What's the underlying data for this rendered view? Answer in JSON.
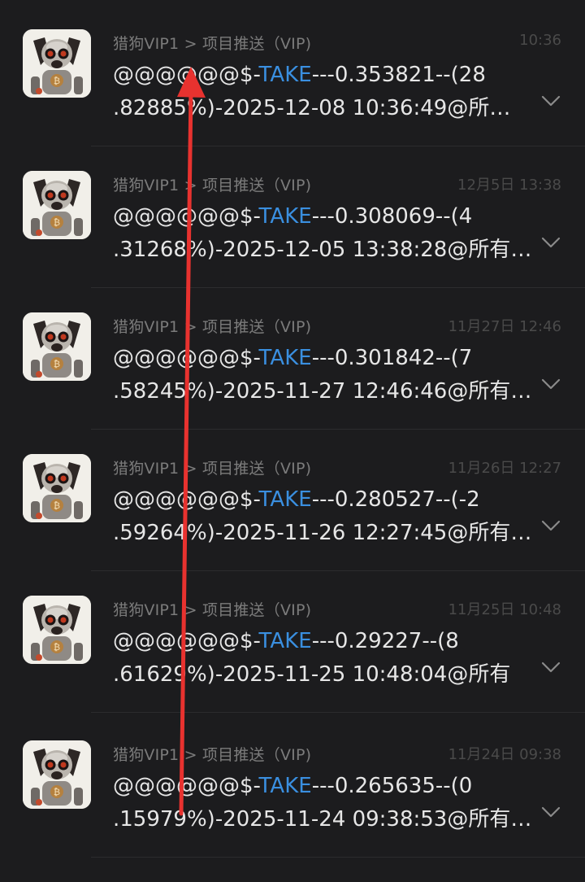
{
  "messages": [
    {
      "sender": "猎狗VIP1 > 项目推送（VIP)",
      "time": "10:36",
      "line1_prefix": "@@@@@@$-",
      "keyword": "TAKE",
      "line1_suffix": "---0.353821--(28",
      "line2": ".82885%)-2025-12-08 10:36:49@所…"
    },
    {
      "sender": "猎狗VIP1 > 项目推送（VIP)",
      "time": "12月5日 13:38",
      "line1_prefix": "@@@@@@$-",
      "keyword": "TAKE",
      "line1_suffix": "---0.308069--(4",
      "line2": ".31268%)-2025-12-05 13:38:28@所有…"
    },
    {
      "sender": "猎狗VIP1 > 项目推送（VIP)",
      "time": "11月27日 12:46",
      "line1_prefix": "@@@@@@$-",
      "keyword": "TAKE",
      "line1_suffix": "---0.301842--(7",
      "line2": ".58245%)-2025-11-27 12:46:46@所有…"
    },
    {
      "sender": "猎狗VIP1 > 项目推送（VIP)",
      "time": "11月26日 12:27",
      "line1_prefix": "@@@@@@$-",
      "keyword": "TAKE",
      "line1_suffix": "---0.280527--(-2",
      "line2": ".59264%)-2025-11-26 12:27:45@所有…"
    },
    {
      "sender": "猎狗VIP1 > 项目推送（VIP)",
      "time": "11月25日 10:48",
      "line1_prefix": "@@@@@@$-",
      "keyword": "TAKE",
      "line1_suffix": "---0.29227--(8",
      "line2": ".61629%)-2025-11-25 10:48:04@所有"
    },
    {
      "sender": "猎狗VIP1 > 项目推送（VIP)",
      "time": "11月24日 09:38",
      "line1_prefix": "@@@@@@$-",
      "keyword": "TAKE",
      "line1_suffix": "---0.265635--(0",
      "line2": ".15979%)-2025-11-24 09:38:53@所有…"
    }
  ],
  "colors": {
    "background": "#1c1c1e",
    "keyword": "#3a8fe0",
    "annotation_arrow": "#e8322f"
  },
  "icons": {
    "avatar": "robot-dog-avatar-icon",
    "expand": "chevron-down-icon"
  }
}
